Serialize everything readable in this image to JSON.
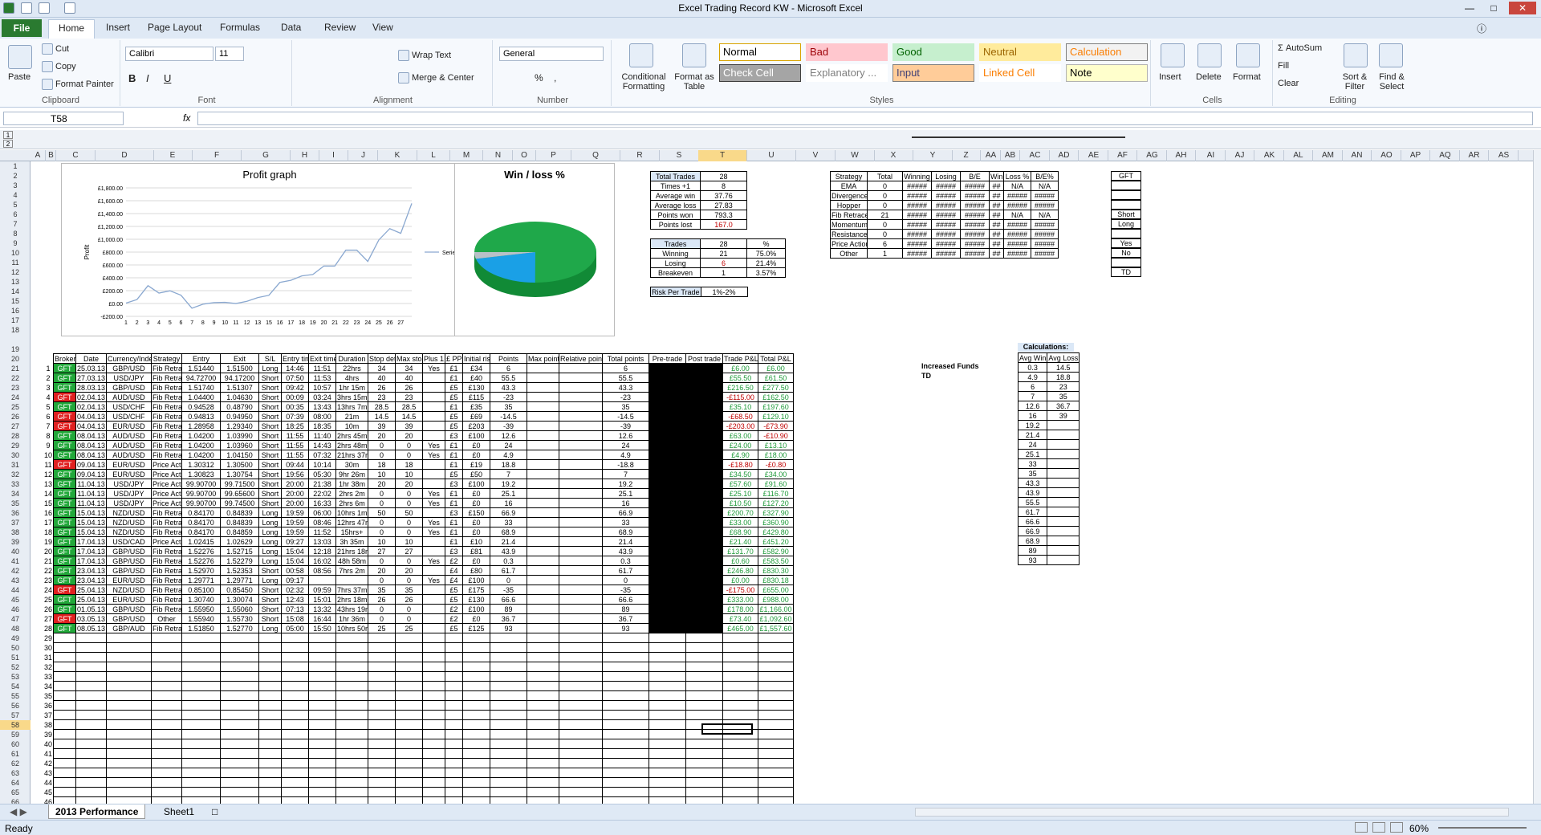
{
  "window": {
    "title": "Excel Trading Record KW  -  Microsoft Excel"
  },
  "tabs": [
    "Home",
    "Insert",
    "Page Layout",
    "Formulas",
    "Data",
    "Review",
    "View"
  ],
  "file_tab": "File",
  "ribbon": {
    "clipboard": {
      "label": "Clipboard",
      "paste": "Paste",
      "cut": "Cut",
      "copy": "Copy",
      "format_painter": "Format Painter"
    },
    "font": {
      "label": "Font",
      "name": "Calibri",
      "size": "11",
      "bold": "B",
      "italic": "I",
      "underline": "U"
    },
    "alignment": {
      "label": "Alignment",
      "wrap": "Wrap Text",
      "merge": "Merge & Center"
    },
    "number": {
      "label": "Number",
      "format": "General",
      "pct": "%",
      "comma": ","
    },
    "styles": {
      "label": "Styles",
      "cond": "Conditional Formatting",
      "fmt_table": "Format as Table",
      "cells": [
        {
          "t": "Normal",
          "bg": "#ffffff",
          "fg": "#000000",
          "bd": "#d9a300"
        },
        {
          "t": "Bad",
          "bg": "#ffc7ce",
          "fg": "#9c0006",
          "bd": "#ffc7ce"
        },
        {
          "t": "Good",
          "bg": "#c6efce",
          "fg": "#006100",
          "bd": "#c6efce"
        },
        {
          "t": "Neutral",
          "bg": "#ffeb9c",
          "fg": "#9c6500",
          "bd": "#ffeb9c"
        },
        {
          "t": "Calculation",
          "bg": "#f2f2f2",
          "fg": "#fa7d00",
          "bd": "#7f7f7f"
        },
        {
          "t": "Check Cell",
          "bg": "#a5a5a5",
          "fg": "#ffffff",
          "bd": "#3f3f3f"
        },
        {
          "t": "Explanatory ...",
          "bg": "#ffffff",
          "fg": "#7f7f7f",
          "bd": "#ffffff"
        },
        {
          "t": "Input",
          "bg": "#ffcc99",
          "fg": "#3f3f76",
          "bd": "#7f7f7f"
        },
        {
          "t": "Linked Cell",
          "bg": "#ffffff",
          "fg": "#fa7d00",
          "bd": "#ffffff"
        },
        {
          "t": "Note",
          "bg": "#ffffcc",
          "fg": "#000000",
          "bd": "#b2b2b2"
        }
      ]
    },
    "cells": {
      "label": "Cells",
      "insert": "Insert",
      "delete": "Delete",
      "format": "Format"
    },
    "editing": {
      "label": "Editing",
      "autosum": "AutoSum",
      "fill": "Fill",
      "clear": "Clear",
      "sort": "Sort & Filter",
      "find": "Find & Select"
    }
  },
  "formula_bar": {
    "name_box": "T58",
    "fx": "fx",
    "formula": ""
  },
  "columns": [
    "A",
    "B",
    "C",
    "D",
    "E",
    "F",
    "G",
    "H",
    "I",
    "J",
    "K",
    "L",
    "M",
    "N",
    "O",
    "P",
    "Q",
    "R",
    "S",
    "T",
    "U",
    "V",
    "W",
    "X",
    "Y",
    "Z",
    "AA",
    "AB",
    "AC",
    "AD",
    "AE",
    "AF",
    "AG",
    "AH",
    "AI",
    "AJ",
    "AK",
    "AL",
    "AM",
    "AN",
    "AO",
    "AP",
    "AQ",
    "AR",
    "AS"
  ],
  "chart_profit": {
    "title": "Profit graph",
    "ylabel": "Profit",
    "legend": "Series1",
    "yticks": [
      "£1,800.00",
      "£1,600.00",
      "£1,400.00",
      "£1,200.00",
      "£1,000.00",
      "£800.00",
      "£600.00",
      "£400.00",
      "£200.00",
      "£0.00",
      "-£200.00"
    ],
    "xticks": [
      "1",
      "2",
      "3",
      "4",
      "5",
      "6",
      "7",
      "8",
      "9",
      "10",
      "11",
      "12",
      "13",
      "15",
      "16",
      "17",
      "18",
      "19",
      "20",
      "21",
      "22",
      "23",
      "24",
      "25",
      "26",
      "27"
    ]
  },
  "chart_data": [
    {
      "type": "line",
      "title": "Profit graph",
      "ylabel": "Profit",
      "ylim": [
        -200,
        1800
      ],
      "categories": [
        "1",
        "2",
        "3",
        "4",
        "5",
        "6",
        "7",
        "8",
        "9",
        "10",
        "11",
        "12",
        "13",
        "15",
        "16",
        "17",
        "18",
        "19",
        "20",
        "21",
        "22",
        "23",
        "24",
        "25",
        "26",
        "27"
      ],
      "series": [
        {
          "name": "Series1",
          "values": [
            6,
            61.5,
            277.5,
            162.5,
            197.6,
            129.1,
            -73.9,
            -10.9,
            13.1,
            18,
            -0.8,
            34,
            91.6,
            127.2,
            327.9,
            360.9,
            429.8,
            451.2,
            582.9,
            583.5,
            830.3,
            830.18,
            655,
            988,
            1166,
            1092.6,
            1557.6
          ]
        }
      ]
    },
    {
      "type": "pie",
      "title": "Win / loss %",
      "categories": [
        "Winning",
        "Losing",
        "Breakeven"
      ],
      "values": [
        75.0,
        21.4,
        3.57
      ],
      "colors": [
        "#1fa84a",
        "#1aa0e6",
        "#b8c0c8"
      ]
    }
  ],
  "chart_pie": {
    "title": "Win / loss %"
  },
  "summary": [
    [
      "Total Trades",
      "28"
    ],
    [
      "Times +1",
      "8"
    ],
    [
      "Average win",
      "37.76"
    ],
    [
      "Average loss",
      "27.83"
    ],
    [
      "Points won",
      "793.3"
    ],
    [
      "Points lost",
      "167.0"
    ]
  ],
  "wl": {
    "hdr": [
      "Trades",
      "28",
      "%"
    ],
    "rows": [
      [
        "Winning",
        "21",
        "75.0%"
      ],
      [
        "Losing",
        "6",
        "21.4%"
      ],
      [
        "Breakeven",
        "1",
        "3.57%"
      ]
    ]
  },
  "risk": [
    "Risk Per Trade",
    "1%-2%"
  ],
  "strategy": {
    "hdr": [
      "Strategy",
      "Total",
      "Winning",
      "Losing",
      "B/E",
      "Win %",
      "Loss %",
      "B/E%"
    ],
    "rows": [
      [
        "EMA",
        "0",
        "#####",
        "#####",
        "#####",
        "##",
        "N/A",
        "N/A"
      ],
      [
        "Divergence",
        "0",
        "#####",
        "#####",
        "#####",
        "##",
        "#####",
        "#####"
      ],
      [
        "Hopper",
        "0",
        "#####",
        "#####",
        "#####",
        "##",
        "#####",
        "#####"
      ],
      [
        "Fib Retrace",
        "21",
        "#####",
        "#####",
        "#####",
        "##",
        "N/A",
        "N/A"
      ],
      [
        "Momentum",
        "0",
        "#####",
        "#####",
        "#####",
        "##",
        "#####",
        "#####"
      ],
      [
        "Resistance",
        "0",
        "#####",
        "#####",
        "#####",
        "##",
        "#####",
        "#####"
      ],
      [
        "Price Action",
        "6",
        "#####",
        "#####",
        "#####",
        "##",
        "#####",
        "#####"
      ],
      [
        "Other",
        "1",
        "#####",
        "#####",
        "#####",
        "##",
        "#####",
        "#####"
      ]
    ]
  },
  "side_list": [
    "GFT",
    "",
    "",
    "",
    "Short",
    "Long",
    "",
    "Yes",
    "No",
    "",
    "TD"
  ],
  "calc": {
    "title": "Calculations:",
    "hdr": [
      "Avg Win",
      "Avg Loss"
    ],
    "rows": [
      [
        "0.3",
        "14.5"
      ],
      [
        "4.9",
        "18.8"
      ],
      [
        "6",
        "23"
      ],
      [
        "7",
        "35"
      ],
      [
        "12.6",
        "36.7"
      ],
      [
        "16",
        "39"
      ],
      [
        "19.2",
        ""
      ],
      [
        "21.4",
        ""
      ],
      [
        "24",
        ""
      ],
      [
        "25.1",
        ""
      ],
      [
        "33",
        ""
      ],
      [
        "35",
        ""
      ],
      [
        "43.3",
        ""
      ],
      [
        "43.9",
        ""
      ],
      [
        "55.5",
        ""
      ],
      [
        "61.7",
        ""
      ],
      [
        "66.6",
        ""
      ],
      [
        "66.9",
        ""
      ],
      [
        "68.9",
        ""
      ],
      [
        "89",
        ""
      ],
      [
        "93",
        ""
      ]
    ]
  },
  "increased": [
    "Increased Funds",
    "TD"
  ],
  "trades_hdr": [
    "Broker",
    "Date",
    "Currency/Index",
    "Strategy",
    "Entry",
    "Exit",
    "S/L",
    "Entry time",
    "Exit time",
    "Duration",
    "Stop detail",
    "Max stop",
    "Plus 1",
    "£ PP",
    "Initial risk",
    "Points",
    "Max points",
    "Relative points",
    "Total points",
    "Pre-trade",
    "Post trade",
    "Trade P&L",
    "Total P&L"
  ],
  "trades": [
    [
      "GFT",
      "25.03.13",
      "GBP/USD",
      "Fib Retrace",
      "1.51440",
      "1.51500",
      "Long",
      "14:46",
      "11:51",
      "22hrs",
      "34",
      "34",
      "Yes",
      "£1",
      "£34",
      "6",
      "",
      "",
      "6",
      "",
      "",
      "£6.00",
      "£6.00"
    ],
    [
      "GFT",
      "27.03.13",
      "USD/JPY",
      "Fib Retrace",
      "94.72700",
      "94.17200",
      "Short",
      "07:50",
      "11:53",
      "4hrs",
      "40",
      "40",
      "",
      "£1",
      "£40",
      "55.5",
      "",
      "",
      "55.5",
      "",
      "",
      "£55.50",
      "£61.50"
    ],
    [
      "GFT",
      "28.03.13",
      "GBP/USD",
      "Fib Retrace",
      "1.51740",
      "1.51307",
      "Short",
      "09:42",
      "10:57",
      "1hr 15m",
      "26",
      "26",
      "",
      "£5",
      "£130",
      "43.3",
      "",
      "",
      "43.3",
      "",
      "",
      "£216.50",
      "£277.50"
    ],
    [
      "GFT",
      "02.04.13",
      "AUD/USD",
      "Fib Retrace",
      "1.04400",
      "1.04630",
      "Short",
      "00:09",
      "03:24",
      "3hrs 15m",
      "23",
      "23",
      "",
      "£5",
      "£115",
      "-23",
      "",
      "",
      "-23",
      "",
      "",
      "-£115.00",
      "£162.50"
    ],
    [
      "GFT",
      "02.04.13",
      "USD/CHF",
      "Fib Retrace",
      "0.94528",
      "0.48790",
      "Short",
      "00:35",
      "13:43",
      "13hrs 7m",
      "28.5",
      "28.5",
      "",
      "£1",
      "£35",
      "35",
      "",
      "",
      "35",
      "",
      "",
      "£35.10",
      "£197.60"
    ],
    [
      "GFT",
      "04.04.13",
      "USD/CHF",
      "Fib Retrace",
      "0.94813",
      "0.94950",
      "Short",
      "07:39",
      "08:00",
      "21m",
      "14.5",
      "14.5",
      "",
      "£5",
      "£69",
      "-14.5",
      "",
      "",
      "-14.5",
      "",
      "",
      "-£68.50",
      "£129.10"
    ],
    [
      "GFT",
      "04.04.13",
      "EUR/USD",
      "Fib Retrace",
      "1.28958",
      "1.29340",
      "Short",
      "18:25",
      "18:35",
      "10m",
      "39",
      "39",
      "",
      "£5",
      "£203",
      "-39",
      "",
      "",
      "-39",
      "",
      "",
      "-£203.00",
      "-£73.90"
    ],
    [
      "GFT",
      "08.04.13",
      "AUD/USD",
      "Fib Retrace",
      "1.04200",
      "1.03990",
      "Short",
      "11:55",
      "11:40",
      "2hrs 45m",
      "20",
      "20",
      "",
      "£3",
      "£100",
      "12.6",
      "",
      "",
      "12.6",
      "",
      "",
      "£63.00",
      "-£10.90"
    ],
    [
      "GFT",
      "08.04.13",
      "AUD/USD",
      "Fib Retrace",
      "1.04200",
      "1.03960",
      "Short",
      "11:55",
      "14:43",
      "2hrs 48m",
      "0",
      "0",
      "Yes",
      "£1",
      "£0",
      "24",
      "",
      "",
      "24",
      "",
      "",
      "£24.00",
      "£13.10"
    ],
    [
      "GFT",
      "08.04.13",
      "AUD/USD",
      "Fib Retrace",
      "1.04200",
      "1.04150",
      "Short",
      "11:55",
      "07:32",
      "21hrs 37m",
      "0",
      "0",
      "Yes",
      "£1",
      "£0",
      "4.9",
      "",
      "",
      "4.9",
      "",
      "",
      "£4.90",
      "£18.00"
    ],
    [
      "GFT",
      "09.04.13",
      "EUR/USD",
      "Price Action",
      "1.30312",
      "1.30500",
      "Short",
      "09:44",
      "10:14",
      "30m",
      "18",
      "18",
      "",
      "£1",
      "£19",
      "18.8",
      "",
      "",
      "-18.8",
      "",
      "",
      "-£18.80",
      "-£0.80"
    ],
    [
      "GFT",
      "09.04.13",
      "EUR/USD",
      "Price Action",
      "1.30823",
      "1.30754",
      "Short",
      "19:56",
      "05:30",
      "9hr 26m",
      "10",
      "10",
      "",
      "£5",
      "£50",
      "7",
      "",
      "",
      "7",
      "",
      "",
      "£34.50",
      "£34.00"
    ],
    [
      "GFT",
      "11.04.13",
      "USD/JPY",
      "Price Action",
      "99.90700",
      "99.71500",
      "Short",
      "20:00",
      "21:38",
      "1hr 38m",
      "20",
      "20",
      "",
      "£3",
      "£100",
      "19.2",
      "",
      "",
      "19.2",
      "",
      "",
      "£57.60",
      "£91.60"
    ],
    [
      "GFT",
      "11.04.13",
      "USD/JPY",
      "Price Action",
      "99.90700",
      "99.65600",
      "Short",
      "20:00",
      "22:02",
      "2hrs 2m",
      "0",
      "0",
      "Yes",
      "£1",
      "£0",
      "25.1",
      "",
      "",
      "25.1",
      "",
      "",
      "£25.10",
      "£116.70"
    ],
    [
      "GFT",
      "11.04.13",
      "USD/JPY",
      "Price Action",
      "99.90700",
      "99.74500",
      "Short",
      "20:00",
      "16:33",
      "2hrs 6m",
      "0",
      "0",
      "Yes",
      "£1",
      "£0",
      "16",
      "",
      "",
      "16",
      "",
      "",
      "£10.50",
      "£127.20"
    ],
    [
      "GFT",
      "15.04.13",
      "NZD/USD",
      "Fib Retrace",
      "0.84170",
      "0.84839",
      "Long",
      "19:59",
      "06:00",
      "10hrs 1m",
      "50",
      "50",
      "",
      "£3",
      "£150",
      "66.9",
      "",
      "",
      "66.9",
      "",
      "",
      "£200.70",
      "£327.90"
    ],
    [
      "GFT",
      "15.04.13",
      "NZD/USD",
      "Fib Retrace",
      "0.84170",
      "0.84839",
      "Long",
      "19:59",
      "08:46",
      "12hrs 47m",
      "0",
      "0",
      "Yes",
      "£1",
      "£0",
      "33",
      "",
      "",
      "33",
      "",
      "",
      "£33.00",
      "£360.90"
    ],
    [
      "GFT",
      "15.04.13",
      "NZD/USD",
      "Fib Retrace",
      "0.84170",
      "0.84859",
      "Long",
      "19:59",
      "11:52",
      "15hrs+",
      "0",
      "0",
      "Yes",
      "£1",
      "£0",
      "68.9",
      "",
      "",
      "68.9",
      "",
      "",
      "£68.90",
      "£429.80"
    ],
    [
      "GFT",
      "17.04.13",
      "USD/CAD",
      "Price Action",
      "1.02415",
      "1.02629",
      "Long",
      "09:27",
      "13:03",
      "3h 35m",
      "10",
      "10",
      "",
      "£1",
      "£10",
      "21.4",
      "",
      "",
      "21.4",
      "",
      "",
      "£21.40",
      "£451.20"
    ],
    [
      "GFT",
      "17.04.13",
      "GBP/USD",
      "Fib Retrace",
      "1.52276",
      "1.52715",
      "Long",
      "15:04",
      "12:18",
      "21hrs 18m",
      "27",
      "27",
      "",
      "£3",
      "£81",
      "43.9",
      "",
      "",
      "43.9",
      "",
      "",
      "£131.70",
      "£582.90"
    ],
    [
      "GFT",
      "17.04.13",
      "GBP/USD",
      "Fib Retrace",
      "1.52276",
      "1.52279",
      "Long",
      "15:04",
      "16:02",
      "48h 58m",
      "0",
      "0",
      "Yes",
      "£2",
      "£0",
      "0.3",
      "",
      "",
      "0.3",
      "",
      "",
      "£0.60",
      "£583.50"
    ],
    [
      "GFT",
      "23.04.13",
      "GBP/USD",
      "Fib Retrace",
      "1.52970",
      "1.52353",
      "Short",
      "00:58",
      "08:56",
      "7hrs 2m",
      "20",
      "20",
      "",
      "£4",
      "£80",
      "61.7",
      "",
      "",
      "61.7",
      "",
      "",
      "£246.80",
      "£830.30"
    ],
    [
      "GFT",
      "23.04.13",
      "EUR/USD",
      "Fib Retrace",
      "1.29771",
      "1.29771",
      "Long",
      "09:17",
      "",
      "",
      "0",
      "0",
      "Yes",
      "£4",
      "£100",
      "0",
      "",
      "",
      "0",
      "",
      "",
      "£0.00",
      "£830.18"
    ],
    [
      "GFT",
      "25.04.13",
      "NZD/USD",
      "Fib Retrace",
      "0.85100",
      "0.85450",
      "Short",
      "02:32",
      "09:59",
      "7hrs 37m",
      "35",
      "35",
      "",
      "£5",
      "£175",
      "-35",
      "",
      "",
      "-35",
      "",
      "",
      "-£175.00",
      "£655.00"
    ],
    [
      "GFT",
      "25.04.13",
      "EUR/USD",
      "Fib Retrace",
      "1.30740",
      "1.30074",
      "Short",
      "12:43",
      "15:01",
      "2hrs 18m",
      "26",
      "26",
      "",
      "£5",
      "£130",
      "66.6",
      "",
      "",
      "66.6",
      "",
      "",
      "£333.00",
      "£988.00"
    ],
    [
      "GFT",
      "01.05.13",
      "GBP/USD",
      "Fib Retrace",
      "1.55950",
      "1.55060",
      "Short",
      "07:13",
      "13:32",
      "43hrs 19m",
      "0",
      "0",
      "",
      "£2",
      "£100",
      "89",
      "",
      "",
      "89",
      "",
      "",
      "£178.00",
      "£1,166.00"
    ],
    [
      "GFT",
      "03.05.13",
      "GBP/USD",
      "Other",
      "1.55940",
      "1.55730",
      "Short",
      "15:08",
      "16:44",
      "1hr 36m",
      "0",
      "0",
      "",
      "£2",
      "£0",
      "36.7",
      "",
      "",
      "36.7",
      "",
      "",
      "£73.40",
      "£1,092.60"
    ],
    [
      "GFT",
      "08.05.13",
      "GBP/AUD",
      "Fib Retrace",
      "1.51850",
      "1.52770",
      "Long",
      "05:00",
      "15:50",
      "10hrs 50m",
      "25",
      "25",
      "",
      "£5",
      "£125",
      "93",
      "",
      "",
      "93",
      "",
      "",
      "£465.00",
      "£1,557.60"
    ]
  ],
  "row_status": [
    "g",
    "g",
    "g",
    "r",
    "g",
    "r",
    "r",
    "g",
    "g",
    "g",
    "r",
    "g",
    "g",
    "g",
    "g",
    "g",
    "g",
    "g",
    "g",
    "g",
    "g",
    "g",
    "g",
    "r",
    "g",
    "g",
    "r",
    "g"
  ],
  "sheets": [
    "2013 Performance",
    "Sheet1"
  ],
  "status": {
    "ready": "Ready",
    "zoom": "60%"
  }
}
